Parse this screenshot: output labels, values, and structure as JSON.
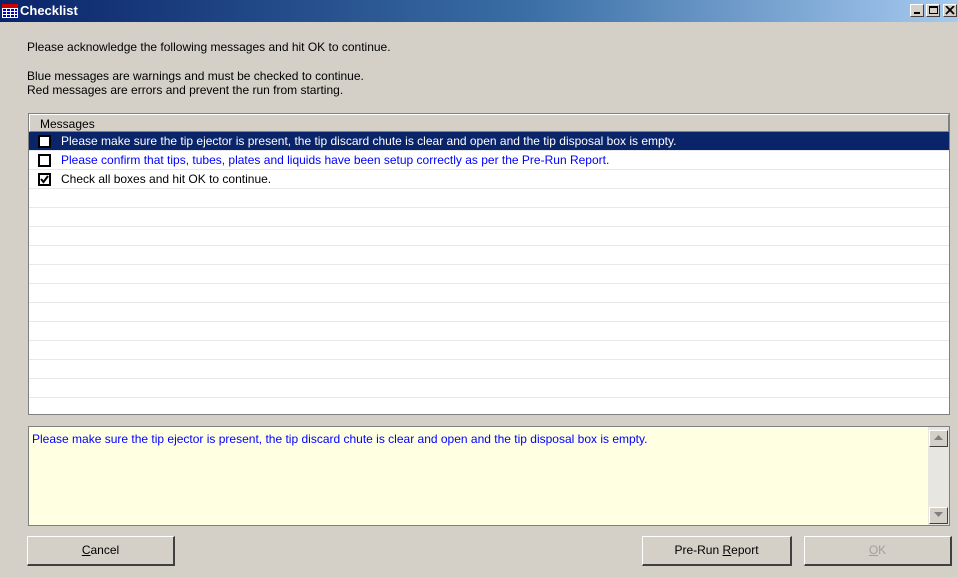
{
  "window": {
    "title": "Checklist"
  },
  "intro": "Please acknowledge the following messages and hit OK to continue.",
  "legend": {
    "line1": "Blue messages are warnings and must be checked to continue.",
    "line2": "Red messages are errors and prevent the run from starting."
  },
  "list": {
    "header": "Messages",
    "items": [
      {
        "text": "Please make sure the tip ejector is present, the tip discard chute is clear and open and the tip disposal box is empty.",
        "checked": false,
        "color": "#0000ff",
        "selected": true
      },
      {
        "text": "Please confirm that tips, tubes, plates and liquids have been setup correctly as per the Pre-Run Report.",
        "checked": false,
        "color": "#0000ff",
        "selected": false
      },
      {
        "text": "Check all boxes and hit OK to continue.",
        "checked": true,
        "color": "#000000",
        "selected": false
      }
    ]
  },
  "detail": {
    "text": "Please make sure the tip ejector is present, the tip discard chute is clear and open and the tip disposal box is empty."
  },
  "buttons": {
    "cancel": {
      "mnemonic": "C",
      "rest": "ancel"
    },
    "prerun": {
      "prefix": "Pre-Run ",
      "mnemonic": "R",
      "rest": "eport"
    },
    "ok": {
      "mnemonic": "O",
      "rest": "K",
      "enabled": false
    }
  },
  "colors": {
    "selection": "#0a246a",
    "warning": "#0000ff",
    "error": "#ff0000",
    "detail_background": "#ffffe1"
  }
}
